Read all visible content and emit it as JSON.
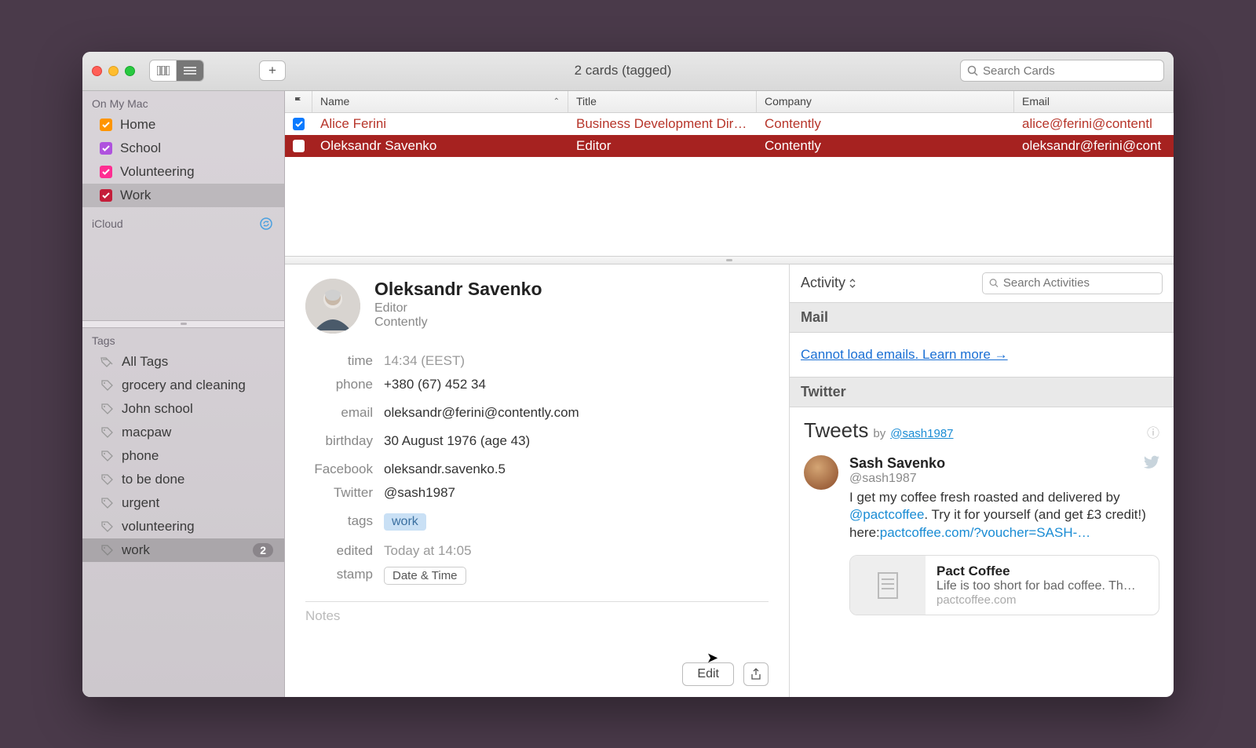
{
  "window_title": "2 cards (tagged)",
  "search_cards_placeholder": "Search Cards",
  "search_activities_placeholder": "Search Activities",
  "sidebar": {
    "section1": "On My Mac",
    "groups": [
      {
        "label": "Home",
        "color": "orange"
      },
      {
        "label": "School",
        "color": "purple"
      },
      {
        "label": "Volunteering",
        "color": "pink"
      },
      {
        "label": "Work",
        "color": "red"
      }
    ],
    "section2": "iCloud",
    "tags_header": "Tags",
    "tags": [
      {
        "label": "All Tags"
      },
      {
        "label": "grocery and cleaning"
      },
      {
        "label": "John school"
      },
      {
        "label": "macpaw"
      },
      {
        "label": "phone"
      },
      {
        "label": "to be done"
      },
      {
        "label": "urgent"
      },
      {
        "label": "volunteering"
      },
      {
        "label": "work",
        "count": "2"
      }
    ]
  },
  "columns": {
    "flag": "",
    "name": "Name",
    "title": "Title",
    "company": "Company",
    "email": "Email"
  },
  "rows": [
    {
      "name": "Alice Ferini",
      "title": "Business Development Dire…",
      "company": "Contently",
      "email": "alice@ferini@contentl"
    },
    {
      "name": "Oleksandr Savenko",
      "title": "Editor",
      "company": "Contently",
      "email": "oleksandr@ferini@cont"
    }
  ],
  "card": {
    "name": "Oleksandr Savenko",
    "subtitle": "Editor",
    "company": "Contently",
    "fields": {
      "time_l": "time",
      "time_v": "14:34 (EEST)",
      "phone_l": "phone",
      "phone_v": "+380 (67) 452 34",
      "email_l": "email",
      "email_v": "oleksandr@ferini@contently.com",
      "birthday_l": "birthday",
      "birthday_v": "30 August 1976 (age 43)",
      "facebook_l": "Facebook",
      "facebook_v": "oleksandr.savenko.5",
      "twitter_l": "Twitter",
      "twitter_v": "@sash1987",
      "tags_l": "tags",
      "tags_v": "work",
      "edited_l": "edited",
      "edited_v": "Today at 14:05",
      "stamp_l": "stamp",
      "stamp_v": "Date & Time"
    },
    "notes_placeholder": "Notes",
    "edit_btn": "Edit"
  },
  "activity": {
    "label": "Activity",
    "mail_header": "Mail",
    "mail_link": "Cannot load emails. Learn more →",
    "twitter_header": "Twitter",
    "tweets_title": "Tweets",
    "by": "by",
    "handle": "@sash1987",
    "tweet": {
      "name": "Sash Savenko",
      "handle": "@sash1987",
      "text_pre": "I get my coffee fresh roasted and delivered by ",
      "mention": "@pactcoffee",
      "text_mid": ". Try it for yourself (and get £3 credit!) here:",
      "link": "pactcoffee.com/?voucher=SASH-…"
    },
    "linkcard": {
      "title": "Pact Coffee",
      "desc": "Life is too short for bad coffee. Th…",
      "url": "pactcoffee.com"
    }
  }
}
